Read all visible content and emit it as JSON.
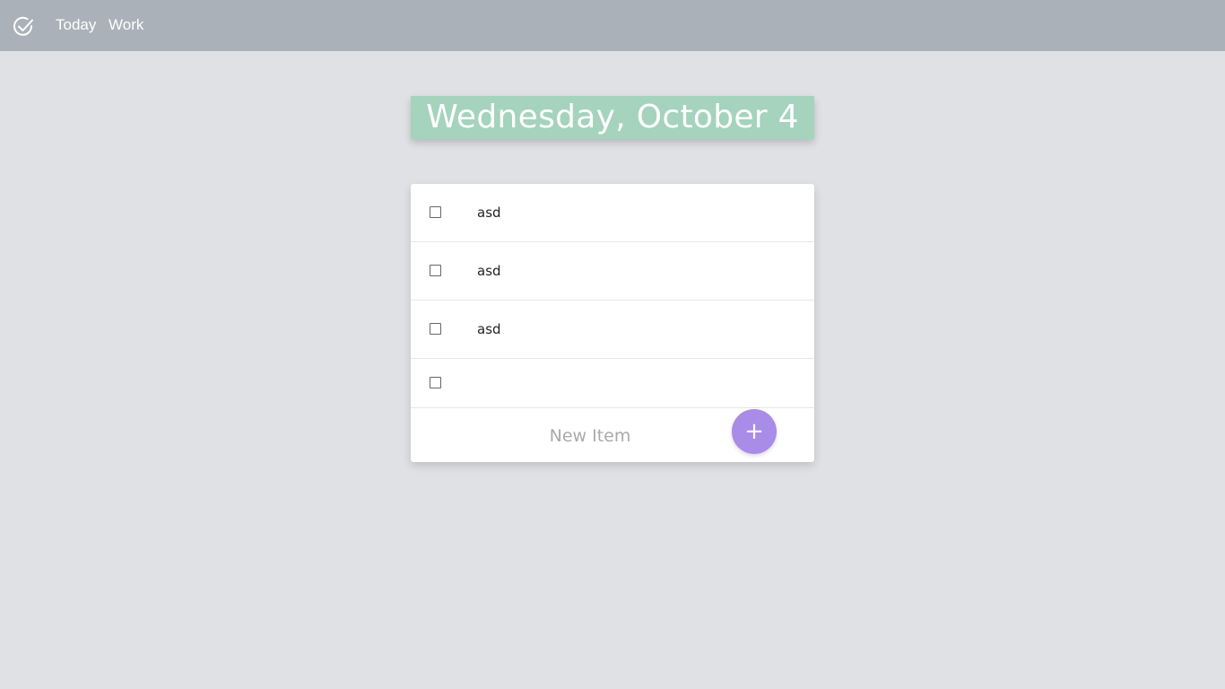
{
  "nav": {
    "logo_icon": "check-circle-icon",
    "links": [
      "Today",
      "Work"
    ]
  },
  "header": {
    "date": "Wednesday, October 4",
    "color": "#a5d3bd"
  },
  "todo": {
    "items": [
      {
        "text": "asd",
        "checked": false
      },
      {
        "text": "asd",
        "checked": false
      },
      {
        "text": "asd",
        "checked": false
      },
      {
        "text": "",
        "checked": false
      }
    ],
    "new_item_placeholder": "New Item",
    "add_button_label": "+",
    "add_button_color": "#a98be8"
  }
}
